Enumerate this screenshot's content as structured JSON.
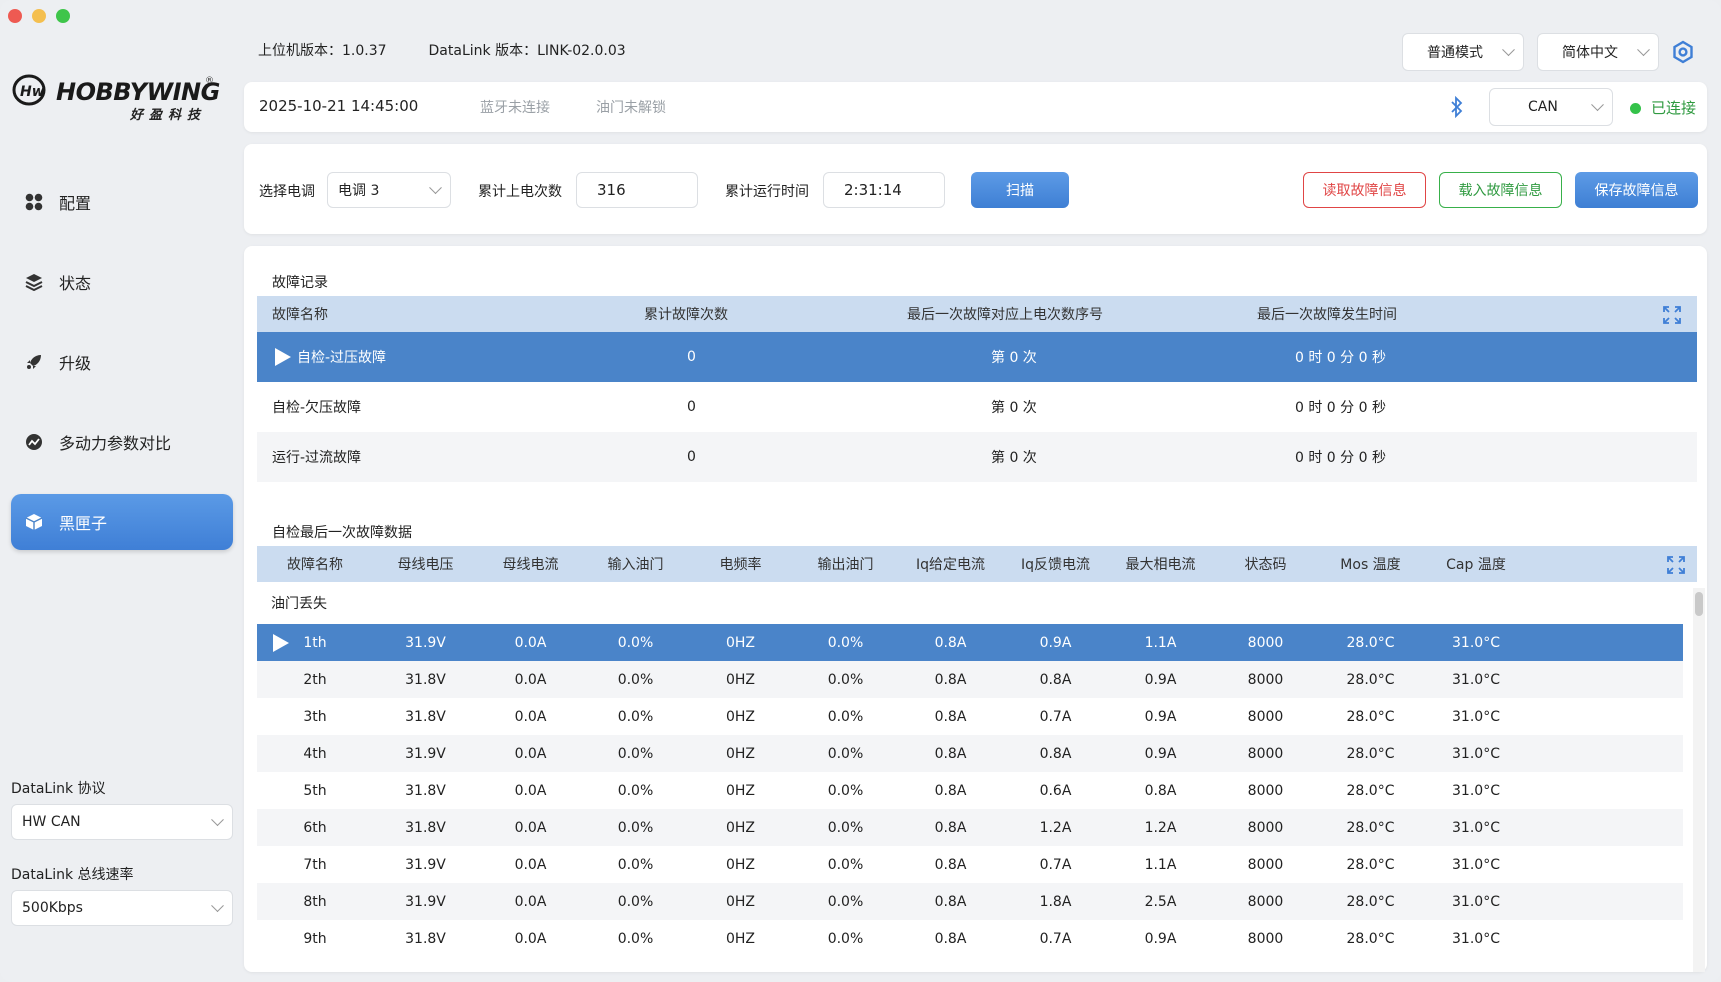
{
  "window": {
    "title": ""
  },
  "brand": {
    "logo_text": "HOBBYWING",
    "logo_sub": "好盈科技",
    "registered": "®"
  },
  "top": {
    "host_version": "上位机版本：1.0.37",
    "datalink_version": "DataLink 版本：LINK-02.0.03",
    "mode_select": "普通模式",
    "lang_select": "简体中文"
  },
  "sidebar": {
    "items": [
      {
        "label": "配置",
        "icon": "grid-icon"
      },
      {
        "label": "状态",
        "icon": "layers-icon"
      },
      {
        "label": "升级",
        "icon": "rocket-icon"
      },
      {
        "label": "多动力参数对比",
        "icon": "gauge-icon"
      },
      {
        "label": "黑匣子",
        "icon": "box-icon",
        "active": true
      }
    ],
    "protocol_label": "DataLink 协议",
    "protocol_value": "HW CAN",
    "rate_label": "DataLink 总线速率",
    "rate_value": "500Kbps"
  },
  "status": {
    "datetime": "2025-10-21 14:45:00",
    "bluetooth": "蓝牙未连接",
    "throttle": "油门未解锁",
    "bus_select": "CAN",
    "connection": "已连接"
  },
  "controls": {
    "esc_label": "选择电调",
    "esc_value": "电调 3",
    "power_count_label": "累计上电次数",
    "power_count_value": "316",
    "runtime_label": "累计运行时间",
    "runtime_value": "2:31:14",
    "scan_button": "扫描",
    "read_button": "读取故障信息",
    "load_button": "载入故障信息",
    "save_button": "保存故障信息"
  },
  "fault_record": {
    "title": "故障记录",
    "headers": [
      "故障名称",
      "累计故障次数",
      "最后一次故障对应上电次数序号",
      "最后一次故障发生时间"
    ],
    "rows": [
      {
        "name": "自检-过压故障",
        "count": "0",
        "seq": "第 0 次",
        "time": "0 时 0 分 0 秒",
        "selected": true
      },
      {
        "name": "自检-欠压故障",
        "count": "0",
        "seq": "第 0 次",
        "time": "0 时 0 分 0 秒"
      },
      {
        "name": "运行-过流故障",
        "count": "0",
        "seq": "第 0 次",
        "time": "0 时 0 分 0 秒"
      }
    ]
  },
  "last_fault": {
    "title": "自检最后一次故障数据",
    "headers": [
      "故障名称",
      "母线电压",
      "母线电流",
      "输入油门",
      "电频率",
      "输出油门",
      "Iq给定电流",
      "Iq反馈电流",
      "最大相电流",
      "状态码",
      "Mos 温度",
      "Cap 温度"
    ],
    "group": "油门丢失",
    "rows": [
      [
        "1th",
        "31.9V",
        "0.0A",
        "0.0%",
        "0HZ",
        "0.0%",
        "0.8A",
        "0.9A",
        "1.1A",
        "8000",
        "28.0°C",
        "31.0°C"
      ],
      [
        "2th",
        "31.8V",
        "0.0A",
        "0.0%",
        "0HZ",
        "0.0%",
        "0.8A",
        "0.8A",
        "0.9A",
        "8000",
        "28.0°C",
        "31.0°C"
      ],
      [
        "3th",
        "31.8V",
        "0.0A",
        "0.0%",
        "0HZ",
        "0.0%",
        "0.8A",
        "0.7A",
        "0.9A",
        "8000",
        "28.0°C",
        "31.0°C"
      ],
      [
        "4th",
        "31.9V",
        "0.0A",
        "0.0%",
        "0HZ",
        "0.0%",
        "0.8A",
        "0.8A",
        "0.9A",
        "8000",
        "28.0°C",
        "31.0°C"
      ],
      [
        "5th",
        "31.8V",
        "0.0A",
        "0.0%",
        "0HZ",
        "0.0%",
        "0.8A",
        "0.6A",
        "0.8A",
        "8000",
        "28.0°C",
        "31.0°C"
      ],
      [
        "6th",
        "31.8V",
        "0.0A",
        "0.0%",
        "0HZ",
        "0.0%",
        "0.8A",
        "1.2A",
        "1.2A",
        "8000",
        "28.0°C",
        "31.0°C"
      ],
      [
        "7th",
        "31.9V",
        "0.0A",
        "0.0%",
        "0HZ",
        "0.0%",
        "0.8A",
        "0.7A",
        "1.1A",
        "8000",
        "28.0°C",
        "31.0°C"
      ],
      [
        "8th",
        "31.9V",
        "0.0A",
        "0.0%",
        "0HZ",
        "0.0%",
        "0.8A",
        "1.8A",
        "2.5A",
        "8000",
        "28.0°C",
        "31.0°C"
      ],
      [
        "9th",
        "31.8V",
        "0.0A",
        "0.0%",
        "0HZ",
        "0.0%",
        "0.8A",
        "0.7A",
        "0.9A",
        "8000",
        "28.0°C",
        "31.0°C"
      ]
    ]
  },
  "colors": {
    "accent": "#4a84c9",
    "header_bg": "#cbdcf0",
    "danger": "#e04545",
    "success": "#34c24a"
  }
}
